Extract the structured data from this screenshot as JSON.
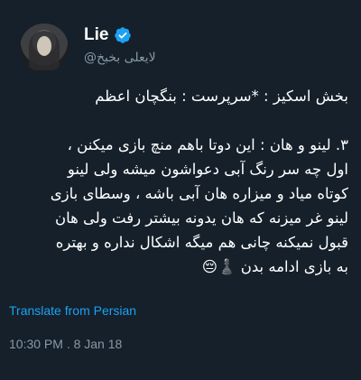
{
  "tweet": {
    "display_name": "Lie",
    "handle": "@لایعلی بخبخ",
    "verified": true,
    "text": "بخش اسکیز : *سرپرست : بنگچان اعظم\n\n۳. لینو و هان : این دوتا باهم منچ بازی میکنن ،\nاول چه سر رنگ آبی دعواشون میشه ولی لینو\nکوتاه میاد و میزاره هان آبی باشه ، وسطای بازی\nلینو غر میزنه که هان یدونه بیشتر رفت ولی هان\nقبول نمیکنه چانی هم میگه اشکال نداره و بهتره\nبه بازی ادامه بدن ♟️😔",
    "translate_label": "Translate from Persian",
    "timestamp": "10:30 PM . 8 Jan 18"
  },
  "icons": {
    "verified_badge": "verified-badge-icon",
    "avatar": "profile-avatar"
  },
  "colors": {
    "background": "#15202b",
    "link": "#1da1f2",
    "secondary_text": "#8899a6",
    "verified": "#1da1f2"
  }
}
